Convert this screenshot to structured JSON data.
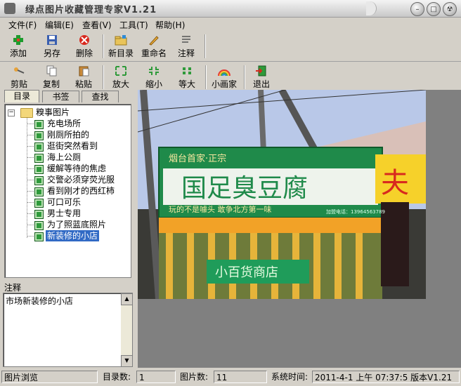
{
  "window": {
    "title": "绿点图片收藏管理专家V1.21"
  },
  "menu": [
    "文件(F)",
    "编辑(E)",
    "查看(V)",
    "工具(T)",
    "帮助(H)"
  ],
  "toolbar1": [
    {
      "label": "添加",
      "icon": "add-icon"
    },
    {
      "label": "另存",
      "icon": "save-icon"
    },
    {
      "label": "删除",
      "icon": "delete-icon"
    },
    {
      "label": "新目录",
      "icon": "new-folder-icon"
    },
    {
      "label": "重命名",
      "icon": "rename-icon"
    },
    {
      "label": "注释",
      "icon": "note-icon"
    }
  ],
  "toolbar2": [
    {
      "label": "剪贴",
      "icon": "cut-icon"
    },
    {
      "label": "复制",
      "icon": "copy-icon"
    },
    {
      "label": "粘贴",
      "icon": "paste-icon"
    },
    {
      "label": "放大",
      "icon": "zoom-in-icon"
    },
    {
      "label": "缩小",
      "icon": "zoom-out-icon"
    },
    {
      "label": "等大",
      "icon": "actual-size-icon"
    },
    {
      "label": "小画家",
      "icon": "paint-icon"
    },
    {
      "label": "退出",
      "icon": "exit-icon"
    }
  ],
  "tabs": [
    "目录",
    "书签",
    "查找"
  ],
  "tree": {
    "root": "糗事图片",
    "items": [
      "充电场所",
      "刚厕所拍的",
      "逛街突然看到",
      "海上公厕",
      "缓解等待的焦虑",
      "交警必须穿荧光服",
      "看到刚才的西红柿",
      "可口可乐",
      "男士专用",
      "为了照蓝底照片",
      "新装修的小店"
    ],
    "selected_index": 10
  },
  "notes": {
    "label": "注释",
    "text": "市场新装修的小店"
  },
  "photo": {
    "sign_top": "烟台首家·正宗",
    "sign_main": "国足臭豆腐",
    "sign_slogan": "玩的不是噱头  敢争北方第一味",
    "sign_phone": "加盟电话：13964563789",
    "sign_lower": "小百货商店",
    "sign_right": "夫"
  },
  "status": {
    "section": "图片浏览",
    "dir_label": "目录数:",
    "dir_value": "1",
    "img_label": "图片数:",
    "img_value": "11",
    "time_label": "系统时间:",
    "time_value": "2011-4-1 上午 07:37:5 版本V1.21"
  },
  "colors": {
    "selection": "#316ac5",
    "sign_green": "#1f8a4a"
  }
}
